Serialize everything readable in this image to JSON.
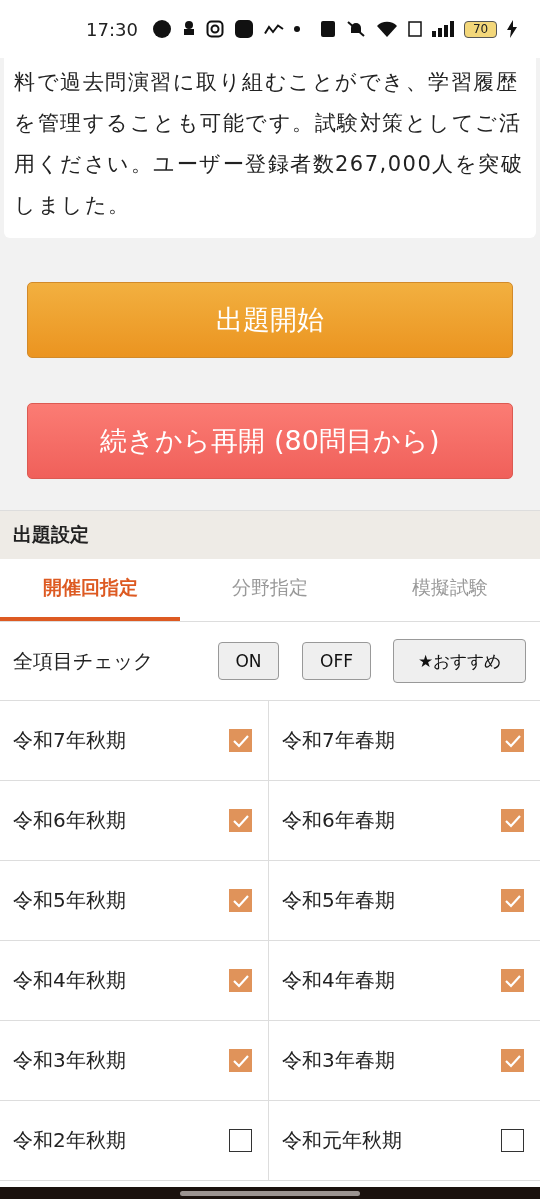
{
  "status_bar": {
    "time": "17:30",
    "battery": "70"
  },
  "intro": {
    "text": "料で過去問演習に取り組むことができ、学習履歴を管理することも可能です。試験対策としてご活用ください。ユーザー登録者数267,000人を突破しました。"
  },
  "buttons": [
    {
      "kind": "start",
      "label": "出題開始"
    },
    {
      "kind": "resume",
      "label": "続きから再開 (80問目から)"
    }
  ],
  "settings": {
    "title": "出題設定",
    "tabs": [
      {
        "label": "開催回指定",
        "selected": true
      },
      {
        "label": "分野指定",
        "selected": false
      },
      {
        "label": "模擬試験",
        "selected": false
      }
    ],
    "check_all": {
      "label": "全項目チェック",
      "buttons": [
        "ON",
        "OFF",
        "★おすすめ"
      ]
    },
    "sessions": [
      {
        "label": "令和7年秋期",
        "checked": true
      },
      {
        "label": "令和7年春期",
        "checked": true
      },
      {
        "label": "令和6年秋期",
        "checked": true
      },
      {
        "label": "令和6年春期",
        "checked": true
      },
      {
        "label": "令和5年秋期",
        "checked": true
      },
      {
        "label": "令和5年春期",
        "checked": true
      },
      {
        "label": "令和4年秋期",
        "checked": true
      },
      {
        "label": "令和4年春期",
        "checked": true
      },
      {
        "label": "令和3年秋期",
        "checked": true
      },
      {
        "label": "令和3年春期",
        "checked": true
      },
      {
        "label": "令和2年秋期",
        "checked": false
      },
      {
        "label": "令和元年秋期",
        "checked": false
      }
    ]
  }
}
